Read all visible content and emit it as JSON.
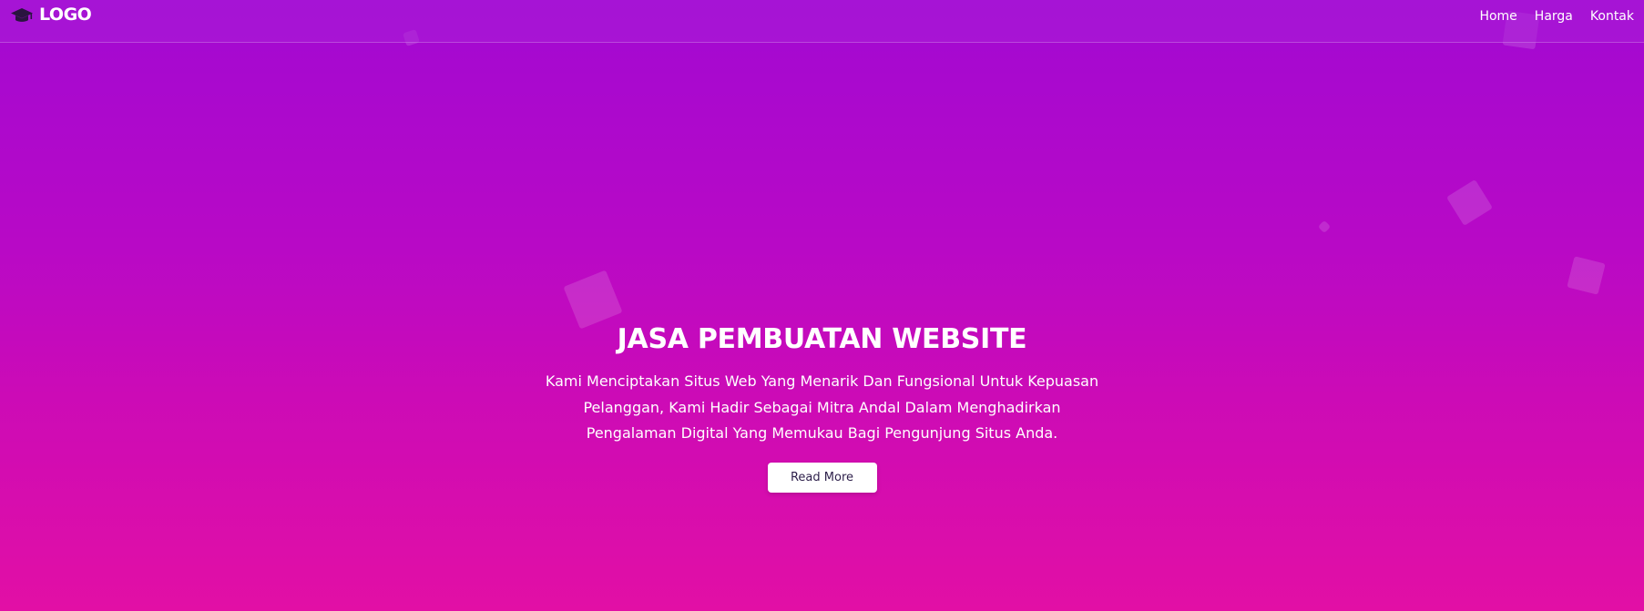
{
  "colors": {
    "gradient_top": "#a209d2",
    "gradient_bottom": "#e20fa5",
    "navbar_bg": "#aa1ed7",
    "text": "#ffffff",
    "button_bg": "#ffffff",
    "button_text": "#2d1f4a"
  },
  "navbar": {
    "logo_icon": "graduation-cap-icon",
    "logo_text": "LOGO",
    "links": [
      {
        "label": "Home"
      },
      {
        "label": "Harga"
      },
      {
        "label": "Kontak"
      }
    ]
  },
  "hero": {
    "title": "JASA PEMBUATAN WEBSITE",
    "description": "Kami Menciptakan Situs Web Yang Menarik Dan Fungsional Untuk Kepuasan Pelanggan, Kami Hadir Sebagai Mitra Andal Dalam Menghadirkan Pengalaman Digital Yang Memukau Bagi Pengunjung Situs Anda.",
    "button_label": "Read More"
  }
}
